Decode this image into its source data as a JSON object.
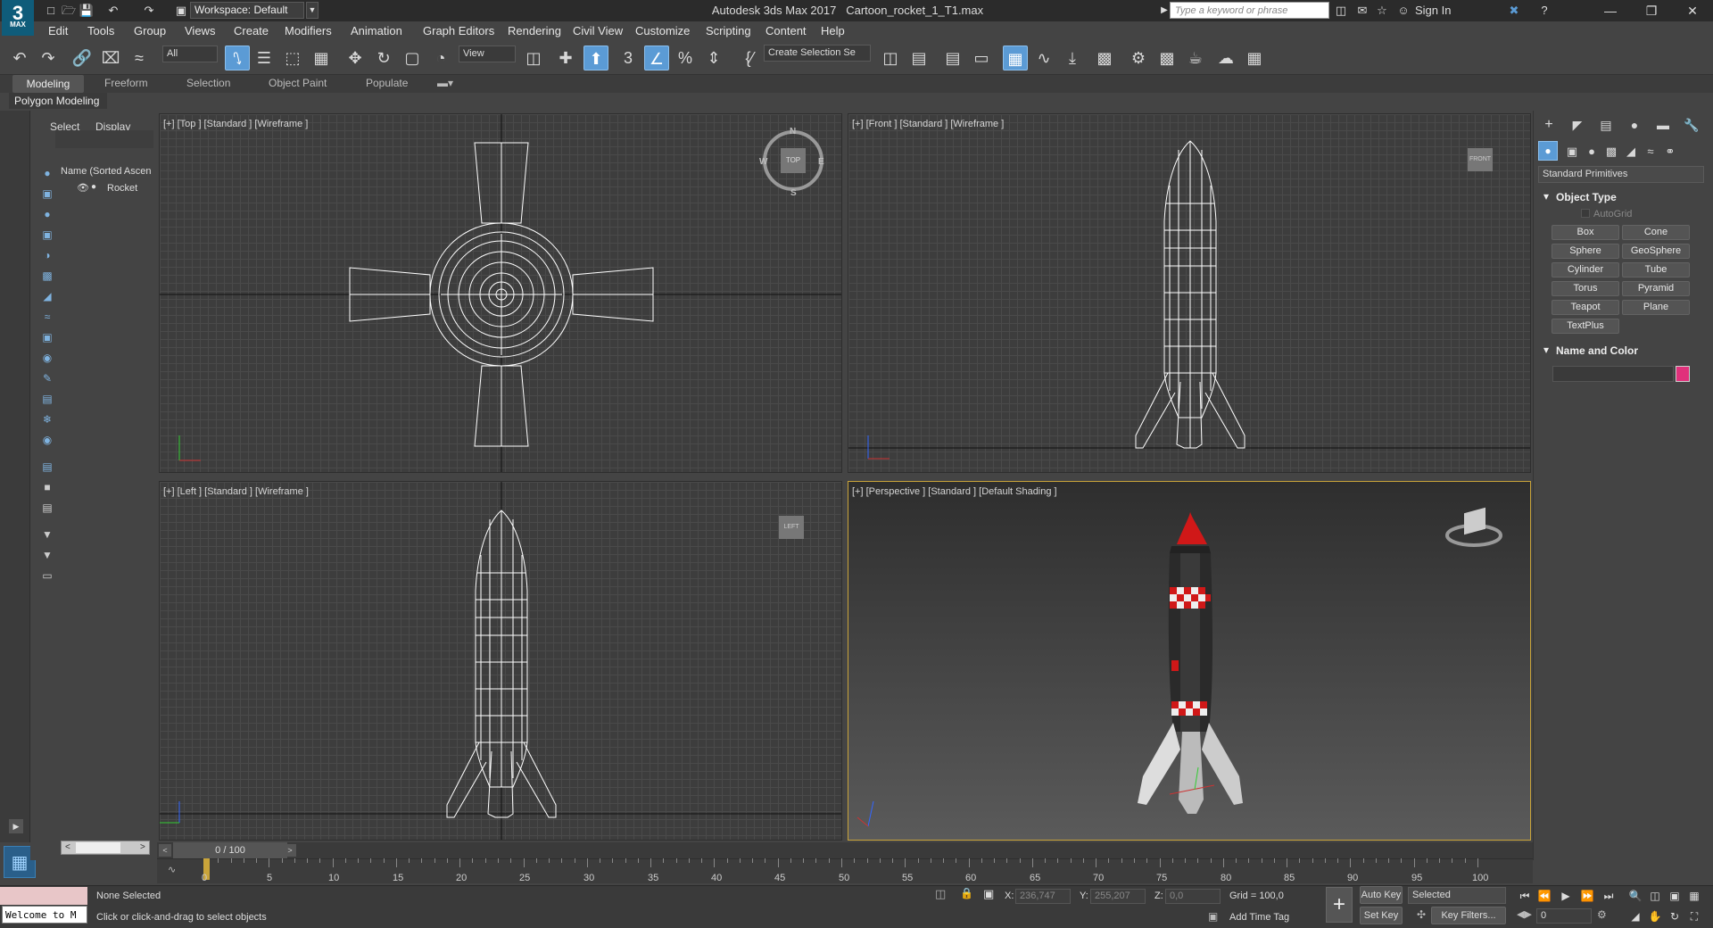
{
  "app": {
    "logo_text": "3",
    "logo_sub": "MAX",
    "workspace": "Workspace: Default",
    "title_app": "Autodesk 3ds Max 2017",
    "title_file": "Cartoon_rocket_1_T1.max",
    "search_placeholder": "Type a keyword or phrase",
    "sign_in": "Sign In"
  },
  "menu": [
    "Edit",
    "Tools",
    "Group",
    "Views",
    "Create",
    "Modifiers",
    "Animation",
    "Graph Editors",
    "Rendering",
    "Civil View",
    "Customize",
    "Scripting",
    "Content",
    "Help"
  ],
  "toolbar": {
    "selection_filter": "All",
    "ref_coord": "View",
    "named_selection": "Create Selection Se"
  },
  "ribbon": {
    "tabs": [
      "Modeling",
      "Freeform",
      "Selection",
      "Object Paint",
      "Populate"
    ],
    "sub_panel": "Polygon Modeling"
  },
  "explorer": {
    "tabs": [
      "Select",
      "Display"
    ],
    "column_header": "Name (Sorted Ascen",
    "items": [
      "Rocket"
    ]
  },
  "viewports": {
    "top": "[+] [Top ] [Standard ] [Wireframe ]",
    "front": "[+] [Front ] [Standard ] [Wireframe ]",
    "left": "[+] [Left ] [Standard ] [Wireframe ]",
    "perspective": "[+] [Perspective ] [Standard ] [Default Shading ]",
    "viewcube_top_label": "TOP",
    "compass": {
      "n": "N",
      "s": "S",
      "e": "E",
      "w": "W"
    }
  },
  "command_panel": {
    "category": "Standard Primitives",
    "object_type_title": "Object Type",
    "autogrid": "AutoGrid",
    "buttons": [
      "Box",
      "Cone",
      "Sphere",
      "GeoSphere",
      "Cylinder",
      "Tube",
      "Torus",
      "Pyramid",
      "Teapot",
      "Plane",
      "TextPlus"
    ],
    "name_color_title": "Name and Color",
    "swatch_color": "#e0317b"
  },
  "timeline": {
    "frame_counter": "0 / 100",
    "ticks": [
      "0",
      "5",
      "10",
      "15",
      "20",
      "25",
      "30",
      "35",
      "40",
      "45",
      "50",
      "55",
      "60",
      "65",
      "70",
      "75",
      "80",
      "85",
      "90",
      "95",
      "100"
    ]
  },
  "status": {
    "maxscript_text": "Welcome to M",
    "selection": "None Selected",
    "prompt": "Click or click-and-drag to select objects",
    "x_label": "X:",
    "x_val": "236,747",
    "y_label": "Y:",
    "y_val": "255,207",
    "z_label": "Z:",
    "z_val": "0,0",
    "grid": "Grid = 100,0",
    "add_time_tag": "Add Time Tag",
    "auto_key": "Auto Key",
    "set_key": "Set Key",
    "key_mode": "Selected",
    "key_filters": "Key Filters...",
    "current_frame": "0"
  }
}
